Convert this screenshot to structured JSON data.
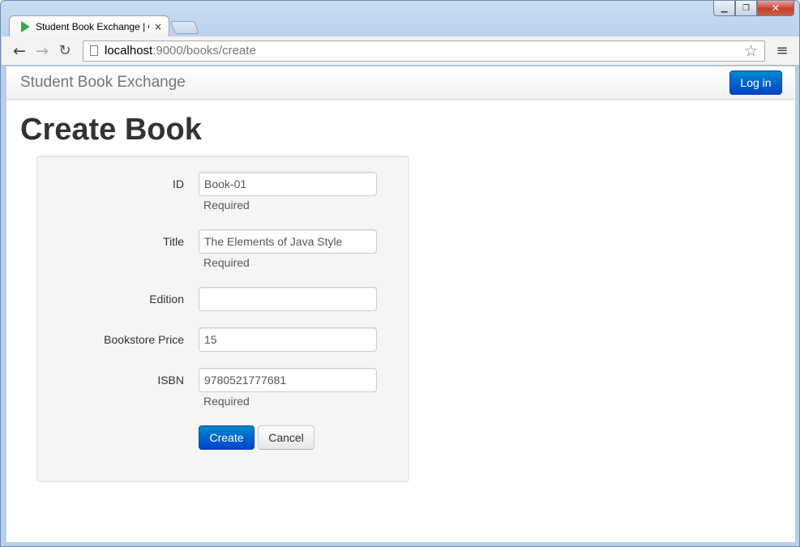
{
  "browser": {
    "tab_title": "Student Book Exchange | C",
    "tab_close": "×",
    "url_host": "localhost",
    "url_rest": ":9000/books/create",
    "icons": {
      "back": "arrow-left-icon",
      "forward": "arrow-right-icon",
      "reload": "reload-icon",
      "star": "star-icon",
      "menu": "menu-icon"
    },
    "window_controls": {
      "minimize": "▁",
      "maximize": "❐",
      "close": "✕"
    }
  },
  "navbar": {
    "brand": "Student Book Exchange",
    "login_label": "Log in"
  },
  "page": {
    "title": "Create Book"
  },
  "form": {
    "fields": [
      {
        "label": "ID",
        "value": "Book-01",
        "help": "Required"
      },
      {
        "label": "Title",
        "value": "The Elements of Java Style",
        "help": "Required"
      },
      {
        "label": "Edition",
        "value": "",
        "help": ""
      },
      {
        "label": "Bookstore Price",
        "value": "15",
        "help": ""
      },
      {
        "label": "ISBN",
        "value": "9780521777681",
        "help": "Required"
      }
    ],
    "create_label": "Create",
    "cancel_label": "Cancel"
  },
  "colors": {
    "primary": "#0055cc",
    "well_bg": "#f5f5f5",
    "favicon": "#3aa84b"
  }
}
